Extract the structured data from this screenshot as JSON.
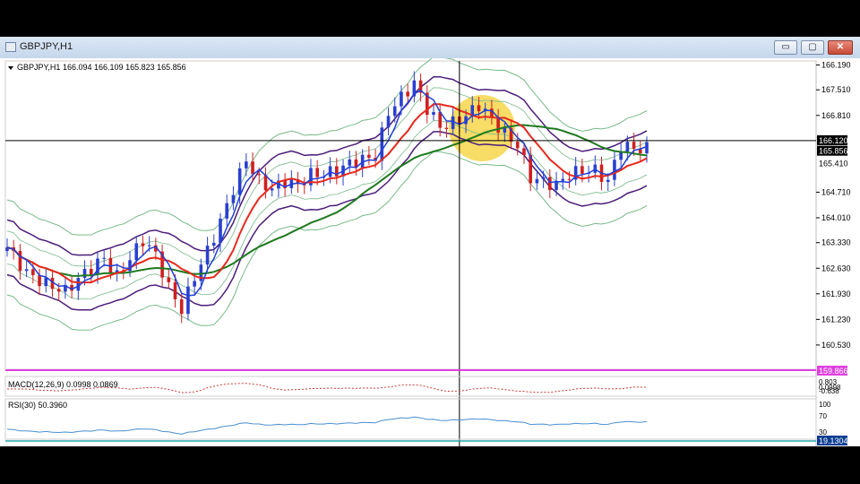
{
  "window": {
    "title": "GBPJPY,H1",
    "buttons": {
      "minimize": "▭",
      "maximize": "▢",
      "close": "✕"
    }
  },
  "colors": {
    "candle_bull": "#2a3fd0",
    "candle_bear": "#d01f1f",
    "ma_fast": "#1f3fd8",
    "ma_red": "#e8291c",
    "ma_green": "#1f7a1f",
    "envelope_purple": "#4b1d7a",
    "bollinger_green": "#79b98a",
    "macd": "#d13b3b",
    "rsi": "#4a8fd0",
    "separator": "#e040e0",
    "highlight": "#f5d23a"
  },
  "chart_data": {
    "type": "candlestick",
    "symbol_label": "GBPJPY,H1",
    "ohlc_label": "166.094 166.109 165.823 165.856",
    "price_axis": {
      "ticks": [
        "166.190",
        "167.510",
        "166.810",
        "164.710",
        "164.010",
        "163.330",
        "162.630",
        "161.930",
        "161.230",
        "160.530"
      ],
      "tick_values": [
        168.19,
        167.51,
        166.81,
        164.71,
        164.01,
        163.33,
        162.63,
        161.93,
        161.23,
        160.53
      ],
      "ylim": [
        159.866,
        168.3
      ],
      "crosshair_label": "166.120",
      "crosshair_value": 166.12,
      "bid_label": "165.856",
      "bid_value": 165.856,
      "lower_label": "165.410",
      "low_level_label": "159.866",
      "low_level_value": 159.866
    },
    "close_anchors": [
      [
        0,
        163.2
      ],
      [
        3,
        162.5
      ],
      [
        6,
        162.2
      ],
      [
        9,
        162.0
      ],
      [
        12,
        162.5
      ],
      [
        15,
        162.9
      ],
      [
        17,
        162.4
      ],
      [
        19,
        162.9
      ],
      [
        21,
        163.4
      ],
      [
        23,
        163.0
      ],
      [
        25,
        162.1
      ],
      [
        27,
        161.5
      ],
      [
        29,
        162.4
      ],
      [
        31,
        163.1
      ],
      [
        33,
        163.9
      ],
      [
        35,
        164.8
      ],
      [
        37,
        165.6
      ],
      [
        39,
        165.0
      ],
      [
        41,
        164.8
      ],
      [
        43,
        165.0
      ],
      [
        45,
        164.9
      ],
      [
        47,
        165.2
      ],
      [
        49,
        165.2
      ],
      [
        51,
        165.3
      ],
      [
        53,
        165.5
      ],
      [
        55,
        165.6
      ],
      [
        57,
        165.7
      ],
      [
        59,
        166.9
      ],
      [
        61,
        167.3
      ],
      [
        63,
        167.7
      ],
      [
        65,
        167.0
      ],
      [
        67,
        166.5
      ],
      [
        69,
        166.6
      ],
      [
        71,
        166.8
      ],
      [
        73,
        167.1
      ],
      [
        75,
        166.7
      ],
      [
        77,
        166.3
      ],
      [
        79,
        166.0
      ],
      [
        81,
        165.1
      ],
      [
        83,
        165.0
      ],
      [
        85,
        164.9
      ],
      [
        87,
        165.2
      ],
      [
        89,
        165.3
      ],
      [
        91,
        165.3
      ],
      [
        93,
        165.0
      ],
      [
        95,
        166.0
      ],
      [
        97,
        165.9
      ],
      [
        99,
        165.9
      ]
    ],
    "candle_count": 100,
    "crosshair_bar": 70,
    "highlight_bars": [
      68,
      74
    ],
    "macd": {
      "label": "MACD(12,26,9) 0.0998 0.0869",
      "axis": [
        "0.803",
        "0.0998",
        "-0.638"
      ]
    },
    "rsi": {
      "label": "RSI(30) 50.3960",
      "axis": [
        "100",
        "70",
        "30"
      ],
      "value_label": "19.1304",
      "value": 50.396
    }
  }
}
